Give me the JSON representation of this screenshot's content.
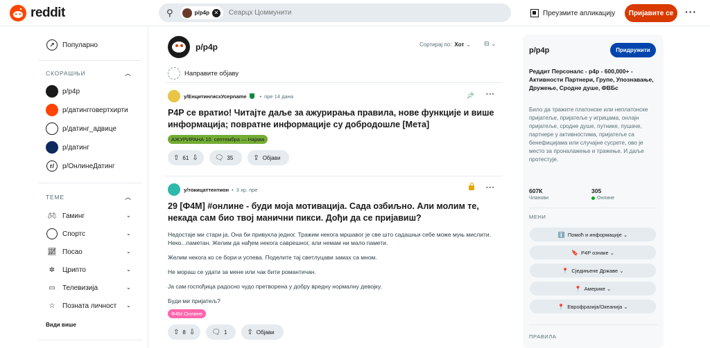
{
  "header": {
    "logo_text": "reddit",
    "search_chip": "p/p4p",
    "search_placeholder": "Сеарцх Цоммунити",
    "get_app": "Преузмите апликацију",
    "login": "Пријавите се",
    "more": "···"
  },
  "leftnav": {
    "popular": "Популарно",
    "recent_section": "СКОРАШЊИ",
    "recent": [
      {
        "label": "p/p4p",
        "color": "#1a1a1b"
      },
      {
        "label": "p/датингговертхирти",
        "color": "#ff4500"
      },
      {
        "label": "p/датинг_адвице",
        "color": "#1a1a1b"
      },
      {
        "label": "p/датинг",
        "color": "#0d2a5e"
      },
      {
        "label": "p/ОнлинеДатинг",
        "color": "#ffffff"
      }
    ],
    "topics_section": "ТЕМЕ",
    "topics": [
      {
        "label": "Гаминг",
        "icon": "gamepad-icon"
      },
      {
        "label": "Спортс",
        "icon": "ball-icon"
      },
      {
        "label": "Посао",
        "icon": "chart-icon"
      },
      {
        "label": "Црипто",
        "icon": "crypto-icon"
      },
      {
        "label": "Телевизија",
        "icon": "tv-icon"
      },
      {
        "label": "Позната личност",
        "icon": "star-icon"
      }
    ],
    "see_more": "Види више"
  },
  "main": {
    "sub_name": "p/p4p",
    "sort_label": "Сортирај по:",
    "sort_value": "Хот",
    "create_post": "Направите објаву",
    "posts": [
      {
        "user": "у/ЕнцитингисхУсерname",
        "time": "пре 14 дана",
        "title": "P4P се вратио! Читајте даље за ажурирања правила, нове функције и више информација; повратне информације су добродошле [Мета]",
        "flair": "АЖУРИРАНА 10. септембра — Најава",
        "flair_color": "#73ad34",
        "votes": "61",
        "comments": "35",
        "share": "Објави"
      },
      {
        "user": "у/токицаттентион",
        "time": "3 хр. пре",
        "title": "29 [Ф4М] #онлине - буди моја мотивација. Сада озбиљно. Али молим те, некада сам био твој манични пикси. Дођи да се пријавиш?",
        "body": [
          "Недостаје ми стари ја. Она би привукла једног. Тражим некога мршавог је све што садашњи себе може муњ мислити. Неко...паметан. Желим да нађем некога саврешног, али немам ни мало памети.",
          "Желим некога ко се бори и успева. Поделите тај светлуцави замах са мном.",
          "Не мораш се удати за мене или чак бити романтичан.",
          "Ја сам госпођица радосно чудо претворена у добру вредну нормалну девојку.",
          "Буди ми пријатељ?"
        ],
        "flair": "Ф4М Онлине",
        "flair_color": "#ff66ac",
        "votes": "8",
        "comments": "1",
        "share": "Објави"
      }
    ]
  },
  "sidebar": {
    "title": "p/p4p",
    "join": "Придружити",
    "headline": "Реддит Персоналс - р4р - 600,000+ - Активности Партнери, Групе, Упознавање, Дружење, Сродне душе, ФВБс",
    "description": "Било да тражите платонске или неплатонске пријатеље, пријатеље у игрицама, онлајн пријатеље, сродне душе, путнике, пушаче, партнере у активностима, пријатеље са бенефицијама или случајне сусрете, ово је место за проналажење и тражење. И даље протестује.",
    "members": "607К",
    "members_label": "Чланови",
    "online": "305",
    "online_label": "Онлине",
    "menu_section": "МЕНИ",
    "menu": [
      {
        "icon": "ℹ️",
        "label": "Помоћ и информације ⌄"
      },
      {
        "icon": "🔖",
        "label": "P4P ознаке ⌄"
      },
      {
        "icon": "📍",
        "label": "Сједињене Државе ⌄"
      },
      {
        "icon": "📍",
        "label": "Америке ⌄"
      },
      {
        "icon": "📍",
        "label": "Еврофразија/Океанија ⌄"
      }
    ],
    "rules_section": "ПРАВИЛА"
  }
}
